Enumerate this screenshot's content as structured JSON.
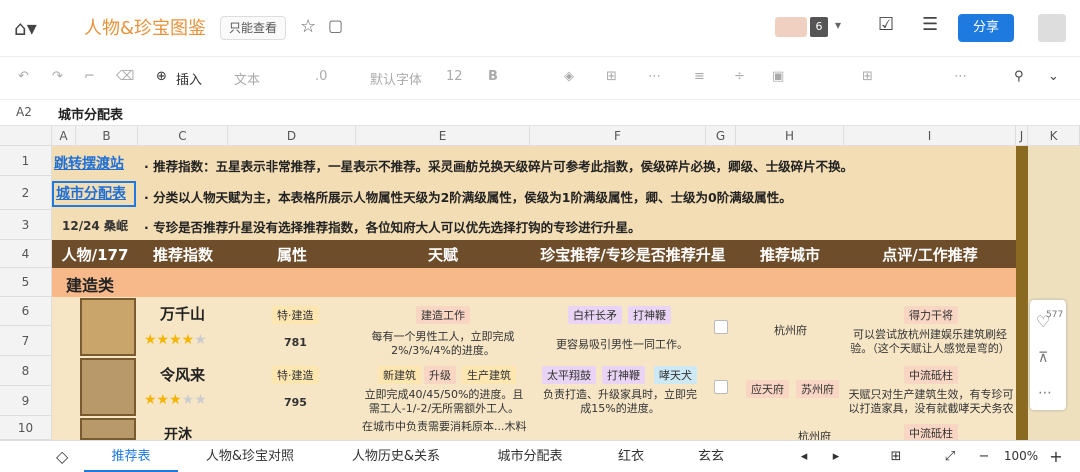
{
  "topbar": {
    "title": "人物&珍宝图鉴",
    "readonly": "只能查看",
    "collab_count": "6",
    "share": "分享"
  },
  "toolbar": {
    "insert": "插入",
    "text": "文本",
    "decimal": ".0",
    "font": "默认字体",
    "size": "12",
    "bold": "B"
  },
  "formula": {
    "cell": "A2",
    "value": "城市分配表"
  },
  "cols": [
    "A",
    "B",
    "C",
    "D",
    "E",
    "F",
    "G",
    "H",
    "I",
    "J",
    "K"
  ],
  "rows": [
    "1",
    "2",
    "3",
    "4",
    "5",
    "6",
    "7",
    "8",
    "9",
    "10"
  ],
  "sheet": {
    "link1": "跳转摆渡站",
    "link2": "城市分配表",
    "date": "12/24 桑岷",
    "info1": "· 推荐指数：五星表示非常推荐，一星表示不推荐。采灵画舫兑换天级碎片可参考此指数，侯级碎片必换，卿级、士级碎片不换。",
    "info2": "· 分类以人物天赋为主，本表格所展示人物属性天级为2阶满级属性，侯级为1阶满级属性，卿、士级为0阶满级属性。",
    "info3": "· 专珍是否推荐升星没有选择推荐指数，各位知府大人可以优先选择打钩的专珍进行升星。",
    "headers": [
      "人物/177",
      "推荐指数",
      "属性",
      "天赋",
      "珍宝推荐/专珍是否推荐升星",
      "推荐城市",
      "点评/工作推荐"
    ],
    "category": "建造类",
    "p1": {
      "name": "万千山",
      "attr": "特·建造",
      "value": "781",
      "talent_tag": "建造工作",
      "talent": "每有一个男性工人，立即完成2%/3%/4%的进度。",
      "treasures": [
        "白杆长矛",
        "打神鞭"
      ],
      "treasure_desc": "更容易吸引男性一同工作。",
      "city": "杭州府",
      "comment_tag": "得力干将",
      "comment": "可以尝试放杭州建娱乐建筑刷经验。（这个天赋让人感觉是弯的）",
      "stars": 4
    },
    "p2": {
      "name": "令风来",
      "attr": "特·建造",
      "value": "795",
      "talent_tags": [
        "新建筑",
        "升级",
        "生产建筑"
      ],
      "talent": "立即完成40/45/50%的进度。且需工人-1/-2/无所需额外工人。",
      "treasures": [
        "太平翔鼓",
        "打神鞭",
        "哮天犬"
      ],
      "treasure_desc": "负责打造、升级家具时，立即完成15%的进度。",
      "cities": [
        "应天府",
        "苏州府"
      ],
      "comment_tag": "中流砥柱",
      "comment": "天赋只对生产建筑生效，有专珍可以打造家具，没有就截哮天犬务农",
      "stars": 3
    },
    "p3": {
      "name": "开沐",
      "row10_text": "在城市中负责需要消耗原本...木料",
      "comment_tag": "中流砥柱",
      "city": "杭州府"
    },
    "side": {
      "num": "577"
    }
  },
  "tabs": [
    "推荐表",
    "人物&珍宝对照",
    "人物历史&关系",
    "城市分配表",
    "红衣",
    "玄玄"
  ],
  "zoom": "100%"
}
